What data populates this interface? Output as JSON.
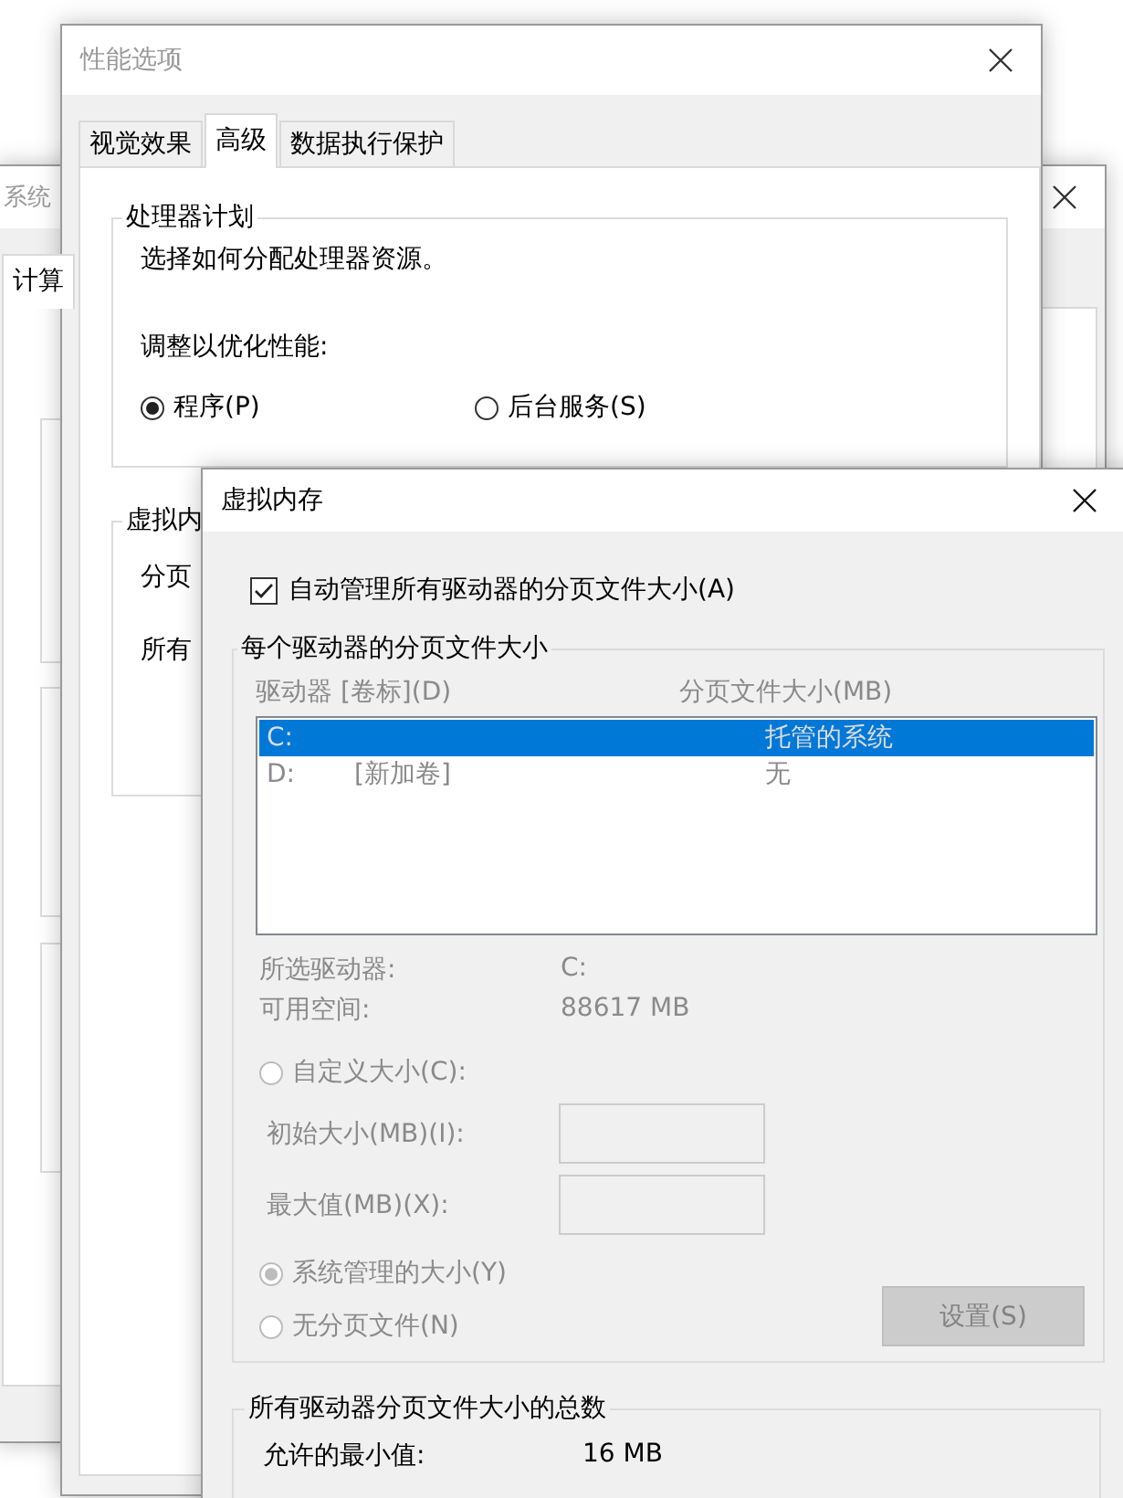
{
  "system_window": {
    "title": "系统",
    "active": false,
    "tabs": [
      {
        "label": "计算",
        "selected": true
      }
    ]
  },
  "performance_window": {
    "title": "性能选项",
    "active": false,
    "tabs": [
      {
        "label": "视觉效果",
        "selected": false
      },
      {
        "label": "高级",
        "selected": true
      },
      {
        "label": "数据执行保护",
        "selected": false
      }
    ],
    "processor_group": {
      "title": "处理器计划",
      "description": "选择如何分配处理器资源。",
      "prompt": "调整以优化性能:",
      "radios": [
        {
          "label": "程序(P)",
          "selected": true
        },
        {
          "label": "后台服务(S)",
          "selected": false
        }
      ]
    },
    "virtual_memory_group": {
      "title": "虚拟内",
      "texts": [
        "分页",
        "所有"
      ]
    }
  },
  "virtual_memory_window": {
    "title": "虚拟内存",
    "active": true,
    "auto_manage": {
      "label": "自动管理所有驱动器的分页文件大小(A)",
      "checked": true
    },
    "per_drive_group": {
      "title": "每个驱动器的分页文件大小",
      "disabled": true,
      "columns": [
        "驱动器 [卷标](D)",
        "分页文件大小(MB)"
      ],
      "drives": [
        {
          "drive": "C:",
          "size": "托管的系统",
          "selected": true
        },
        {
          "drive": "D:",
          "label": "[新加卷]",
          "size": "无",
          "selected": false
        }
      ],
      "details": [
        {
          "label": "所选驱动器:",
          "value": "C:"
        },
        {
          "label": "可用空间:",
          "value": "88617 MB"
        }
      ],
      "options": [
        {
          "kind": "radio",
          "label": "自定义大小(C):",
          "selected": false
        },
        {
          "kind": "field",
          "label": "初始大小(MB)(I):"
        },
        {
          "kind": "field",
          "label": "最大值(MB)(X):"
        },
        {
          "kind": "radio",
          "label": "系统管理的大小(Y)",
          "selected": true
        },
        {
          "kind": "radio",
          "label": "无分页文件(N)",
          "selected": false
        }
      ],
      "set_button": {
        "label": "设置(S)",
        "disabled": true
      }
    },
    "total_group": {
      "title": "所有驱动器分页文件大小的总数",
      "rows": [
        {
          "label": "允许的最小值:",
          "value": "16 MB"
        }
      ]
    }
  }
}
